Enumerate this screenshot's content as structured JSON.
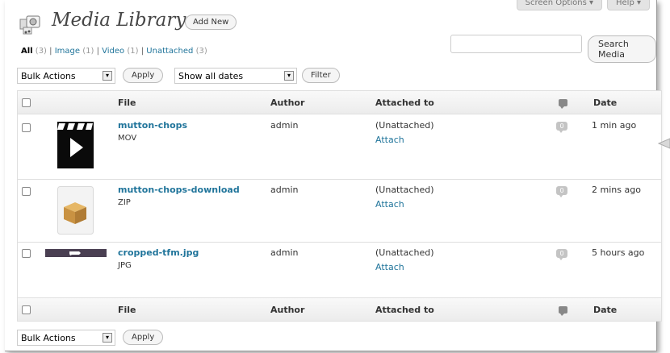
{
  "screen_meta": {
    "screen_options": "Screen Options ▾",
    "help": "Help ▾"
  },
  "header": {
    "title": "Media Library",
    "add_new": "Add New"
  },
  "filters": {
    "all": "All",
    "all_count": "(3)",
    "image": "Image",
    "image_count": "(1)",
    "video": "Video",
    "video_count": "(1)",
    "unattached": "Unattached",
    "unattached_count": "(3)",
    "sep": "|"
  },
  "search": {
    "button": "Search Media",
    "placeholder": ""
  },
  "toolbar": {
    "bulk_actions": "Bulk Actions",
    "apply": "Apply",
    "dates": "Show all dates",
    "filter": "Filter",
    "arrow": "▾"
  },
  "columns": {
    "file": "File",
    "author": "Author",
    "attached": "Attached to",
    "date": "Date"
  },
  "rows": [
    {
      "title": "mutton-chops",
      "type": "MOV",
      "author": "admin",
      "attached": "(Unattached)",
      "attach": "Attach",
      "comments": "0",
      "date": "1 min ago",
      "thumb": "video"
    },
    {
      "title": "mutton-chops-download",
      "type": "ZIP",
      "author": "admin",
      "attached": "(Unattached)",
      "attach": "Attach",
      "comments": "0",
      "date": "2 mins ago",
      "thumb": "archive"
    },
    {
      "title": "cropped-tfm.jpg",
      "type": "JPG",
      "author": "admin",
      "attached": "(Unattached)",
      "attach": "Attach",
      "comments": "0",
      "date": "5 hours ago",
      "thumb": "image"
    }
  ],
  "colors": {
    "link": "#21759b",
    "header_bg": "#ececec",
    "border": "#dfdfdf"
  }
}
